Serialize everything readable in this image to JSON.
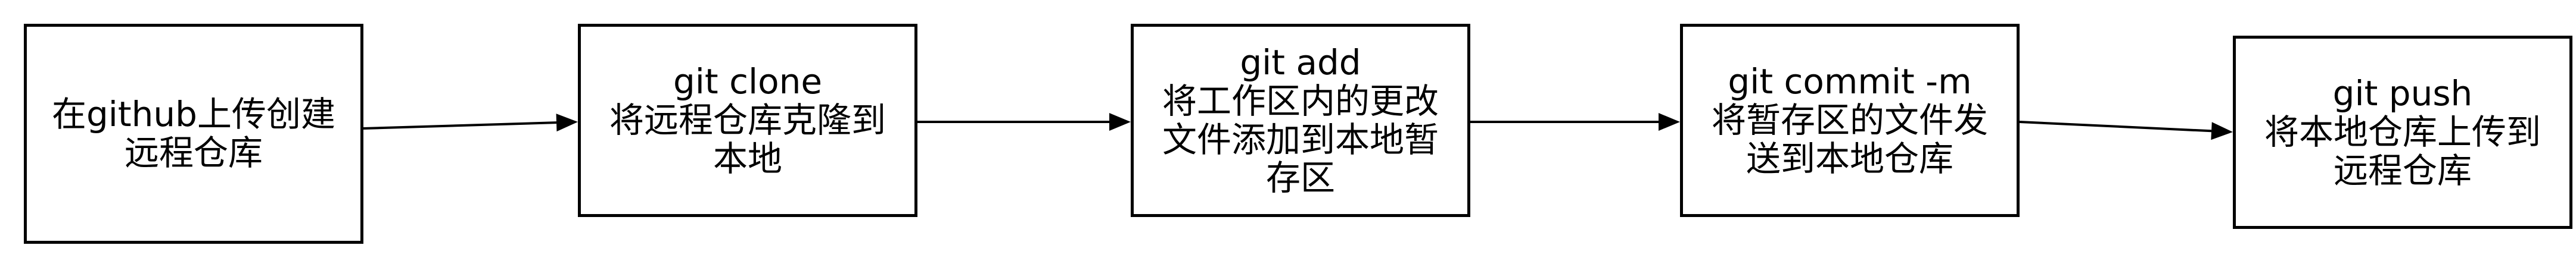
{
  "diagram": {
    "stroke_color": "#000000",
    "nodes": [
      {
        "id": "create-repo",
        "lines": [
          "在github上传创建",
          "远程仓库"
        ]
      },
      {
        "id": "git-clone",
        "lines": [
          "git clone",
          "将远程仓库克隆到",
          "本地"
        ]
      },
      {
        "id": "git-add",
        "lines": [
          "git add",
          "将工作区内的更改",
          "文件添加到本地暂",
          "存区"
        ]
      },
      {
        "id": "git-commit",
        "lines": [
          "git commit -m",
          "将暂存区的文件发",
          "送到本地仓库"
        ]
      },
      {
        "id": "git-push",
        "lines": [
          "git push",
          "将本地仓库上传到",
          "远程仓库"
        ]
      }
    ],
    "edges": [
      {
        "from": "create-repo",
        "to": "git-clone"
      },
      {
        "from": "git-clone",
        "to": "git-add"
      },
      {
        "from": "git-add",
        "to": "git-commit"
      },
      {
        "from": "git-commit",
        "to": "git-push"
      }
    ]
  }
}
